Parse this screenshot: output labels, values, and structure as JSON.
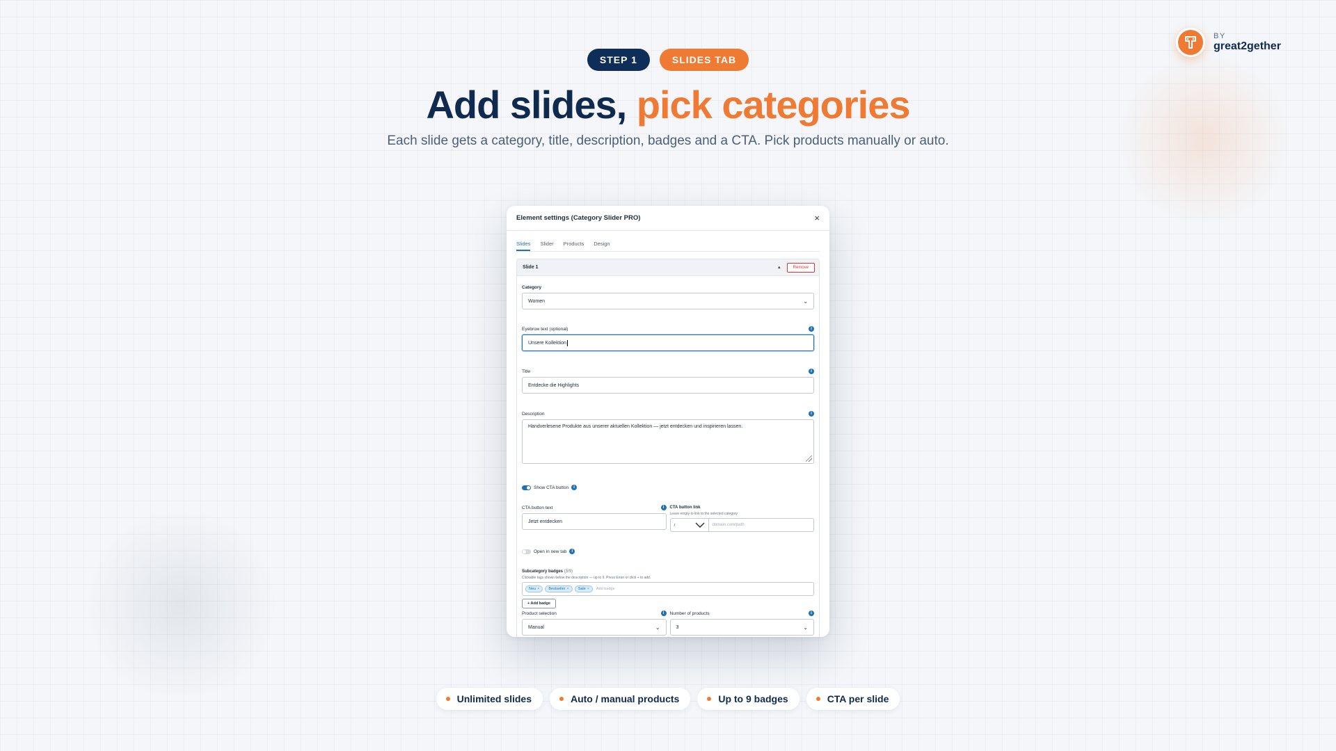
{
  "brand": {
    "by": "BY",
    "name": "great2gether"
  },
  "header": {
    "step_label": "STEP 1",
    "tab_label": "SLIDES TAB",
    "title_main": "Add slides, ",
    "title_accent": "pick categories",
    "subtitle": "Each slide gets a category, title, description, badges and a CTA. Pick products manually or auto."
  },
  "dialog": {
    "title": "Element settings (Category Slider PRO)",
    "close": "×",
    "tabs": [
      "Slides",
      "Slider",
      "Products",
      "Design"
    ],
    "slide": {
      "title": "Slide 1",
      "remove_label": "Remove",
      "category": {
        "label": "Category",
        "value": "Women"
      },
      "eyebrow": {
        "label": "Eyebrow text (optional)",
        "value": "Unsere Kollektion"
      },
      "title_field": {
        "label": "Title",
        "value": "Entdecke die Highlights"
      },
      "description": {
        "label": "Description",
        "value": "Handverlesene Produkte aus unserer aktuellen Kollektion — jetzt entdecken und inspirieren lassen."
      },
      "show_cta": {
        "label": "Show CTA button",
        "on": true
      },
      "cta_text": {
        "label": "CTA button text",
        "value": "Jetzt entdecken"
      },
      "cta_link": {
        "label": "CTA button link",
        "hint": "Leave empty to link to the selected category",
        "scheme": "/",
        "placeholder": "domain.com/path"
      },
      "new_tab": {
        "label": "Open in new tab",
        "on": false
      },
      "badges": {
        "label": "Subcategory badges",
        "count": "(3/9)",
        "hint": "Clickable tags shown below the description — up to 9. Press Enter or click + to add.",
        "items": [
          "Neu",
          "Bestseller",
          "Sale"
        ],
        "placeholder": "Add badge",
        "add_label": "+ Add badge"
      },
      "product_selection": {
        "label": "Product selection",
        "value": "Manual"
      },
      "number_of_products": {
        "label": "Number of products",
        "value": "3"
      }
    }
  },
  "features": [
    "Unlimited slides",
    "Auto / manual products",
    "Up to 9 badges",
    "CTA per slide"
  ],
  "colors": {
    "navy": "#0f2e57",
    "orange": "#ee7a33",
    "wp_blue": "#2271b1",
    "remove_red": "#d63638"
  }
}
